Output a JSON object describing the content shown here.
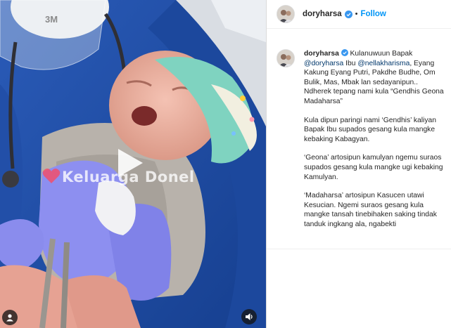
{
  "post": {
    "username": "doryharsa",
    "follow_label": "Follow",
    "separator": "•"
  },
  "media": {
    "watermark": "Keluarga Donel",
    "mask_brand": "3M",
    "type": "video"
  },
  "caption": {
    "username": "doryharsa",
    "line1_a": "Kulanuwuun Bapak",
    "mention1": "@doryharsa",
    "line1_b": "Ibu",
    "mention2": "@nellakharisma",
    "line1_c": ", Eyang Kakung Eyang Putri, Pakdhe Budhe, Om Bulik, Mas, Mbak lan sedayanipun..",
    "line2": "Ndherek tepang nami kula “Gendhis Geona Madaharsa”",
    "para2": "Kula dipun paringi nami ‘Gendhis’ kaliyan Bapak Ibu supados gesang kula mangke kebaking Kabagyan.",
    "para3": "‘Geona’ artosipun kamulyan ngemu suraos supados gesang kula mangke ugi kebaking Kamulyan.",
    "para4": "‘Madaharsa’ artosipun Kasucen utawi Kesucian. Ngemi suraos gesang kula mangke tansah tinebihaken saking tindak tanduk ingkang ala, ngabekti"
  },
  "colors": {
    "follow": "#0095f6",
    "mention": "#00376b",
    "verified": "#3897f0",
    "scrub_blue": "#1f4ea6"
  },
  "icons": [
    "play-icon",
    "verified-badge-icon",
    "user-tag-icon",
    "sound-icon"
  ]
}
